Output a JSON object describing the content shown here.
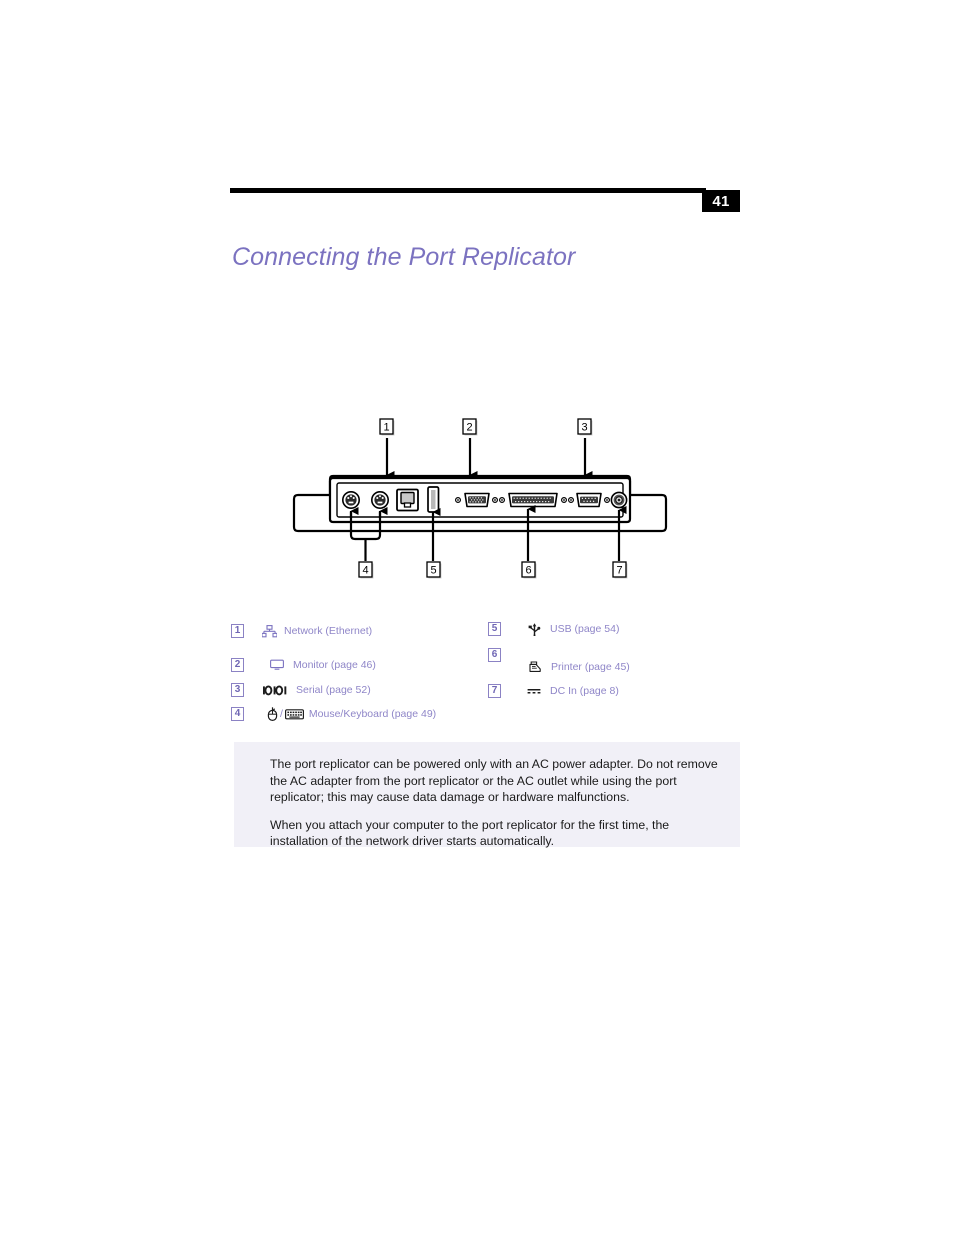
{
  "page": {
    "number": "41",
    "title": "Connecting the Port Replicator"
  },
  "figure": {
    "caption_callouts": [
      "1",
      "2",
      "3",
      "4",
      "5",
      "6",
      "7"
    ],
    "description": "Rear panel of the port replicator showing numbered port callouts"
  },
  "legend": {
    "left": [
      {
        "num": "1",
        "icon": "network-ethernet-icon",
        "label": "Network (Ethernet)"
      },
      {
        "num": "2",
        "icon": "monitor-icon",
        "label": "Monitor (page 46)"
      },
      {
        "num": "3",
        "icon": "serial-icon",
        "label": "Serial (page 52)"
      },
      {
        "num": "4",
        "icon": "mouse-keyboard-icon",
        "label": "Mouse/Keyboard (page 49)",
        "separator": "/"
      }
    ],
    "right": [
      {
        "num": "5",
        "icon": "usb-icon",
        "label": "USB (page 54)"
      },
      {
        "num": "6",
        "icon": "printer-icon",
        "label": "Printer (page 45)"
      },
      {
        "num": "7",
        "icon": "dc-in-icon",
        "label": "DC In (page 8)"
      }
    ]
  },
  "note": {
    "paragraphs": [
      "The port replicator can be powered only with an AC power adapter. Do not remove the AC adapter from the port replicator or the AC outlet while using the port replicator; this may cause data damage or hardware malfunctions.",
      "When you attach your computer to the port replicator for the first time, the installation of the network driver starts automatically."
    ]
  },
  "colors": {
    "accent_purple": "#7b72c0",
    "legend_text": "#8f86c8",
    "note_background": "#f1f0f7",
    "badge_background": "#000000"
  }
}
